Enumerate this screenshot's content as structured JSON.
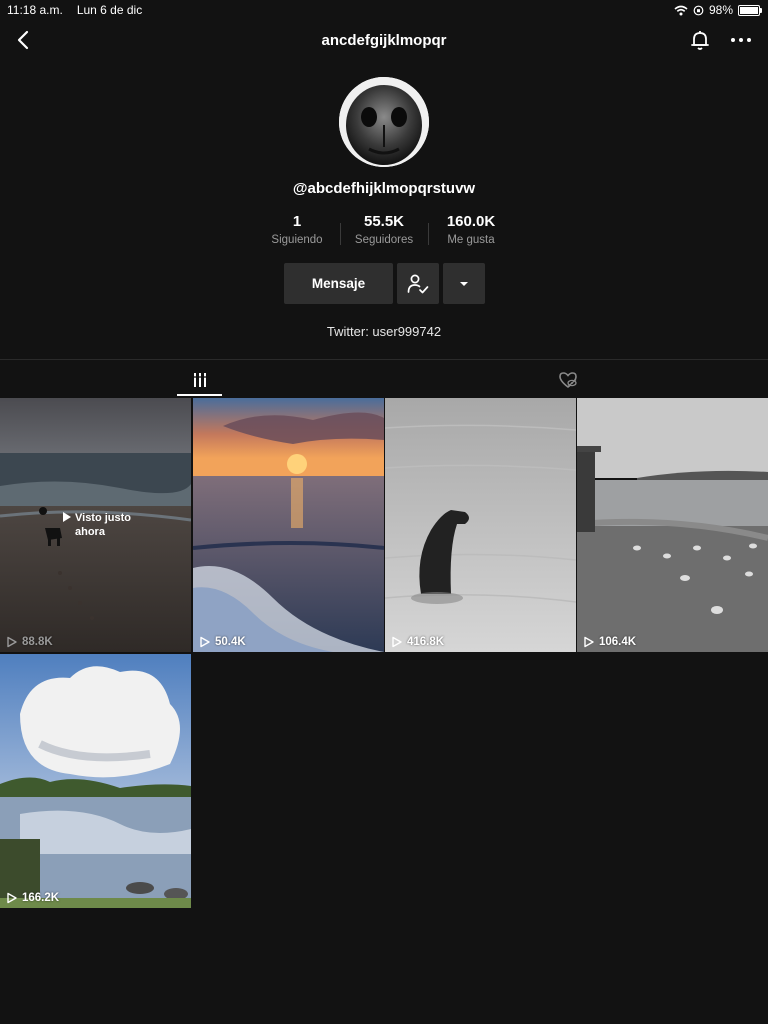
{
  "status_bar": {
    "time": "11:18 a.m.",
    "date": "Lun 6 de dic",
    "battery": "98%",
    "battery_level": 0.98
  },
  "header": {
    "title": "ancdefgijklmopqr"
  },
  "profile": {
    "username": "@abcdefhijklmopqrstuvw",
    "stats": [
      {
        "value": "1",
        "label": "Siguiendo"
      },
      {
        "value": "55.5K",
        "label": "Seguidores"
      },
      {
        "value": "160.0K",
        "label": "Me gusta"
      }
    ],
    "message_button": "Mensaje",
    "bio": "Twitter: user999742"
  },
  "tabs": [
    {
      "icon": "grid-icon",
      "active": true
    },
    {
      "icon": "liked-hidden-icon",
      "active": false
    }
  ],
  "videos": [
    {
      "views": "88.8K",
      "overlay": "Visto justo ahora",
      "scene": "beach-dog-dusk"
    },
    {
      "views": "50.4K",
      "scene": "sunset-waves"
    },
    {
      "views": "416.8K",
      "scene": "dog-in-water"
    },
    {
      "views": "106.4K",
      "scene": "seagulls-shore"
    },
    {
      "views": "166.2K",
      "scene": "lake-clouds"
    }
  ],
  "colors": {
    "background": "#121212",
    "button": "#2f2f2f",
    "muted_text": "#9a9a9a"
  }
}
